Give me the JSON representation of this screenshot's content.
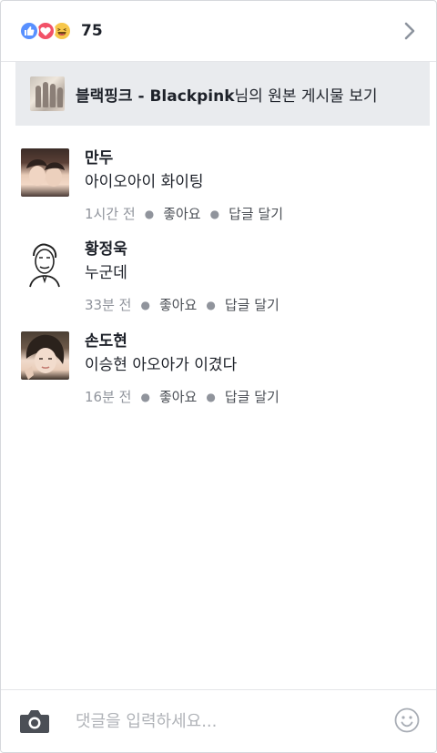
{
  "reactions": {
    "icons": [
      "like-icon",
      "love-icon",
      "haha-icon"
    ],
    "count": "75"
  },
  "original_post": {
    "page_name": "블랙핑크 - Blackpink",
    "suffix": "님의 원본 게시물 보기"
  },
  "comments": [
    {
      "name": "만두",
      "text": "아이오아이 화이팅",
      "time": "1시간 전",
      "like_label": "좋아요",
      "reply_label": "답글 달기"
    },
    {
      "name": "황정욱",
      "text": "누군데",
      "time": "33분 전",
      "like_label": "좋아요",
      "reply_label": "답글 달기"
    },
    {
      "name": "손도현",
      "text": "이승현 아오아가 이겼다",
      "time": "16분 전",
      "like_label": "좋아요",
      "reply_label": "답글 달기"
    }
  ],
  "composer": {
    "placeholder": "댓글을 입력하세요..."
  },
  "colors": {
    "like": "#5890ff",
    "love": "#f25268",
    "haha": "#f7c74b",
    "link": "#4b4f56",
    "meta": "#90949c",
    "banner_bg": "#e9ebee"
  }
}
